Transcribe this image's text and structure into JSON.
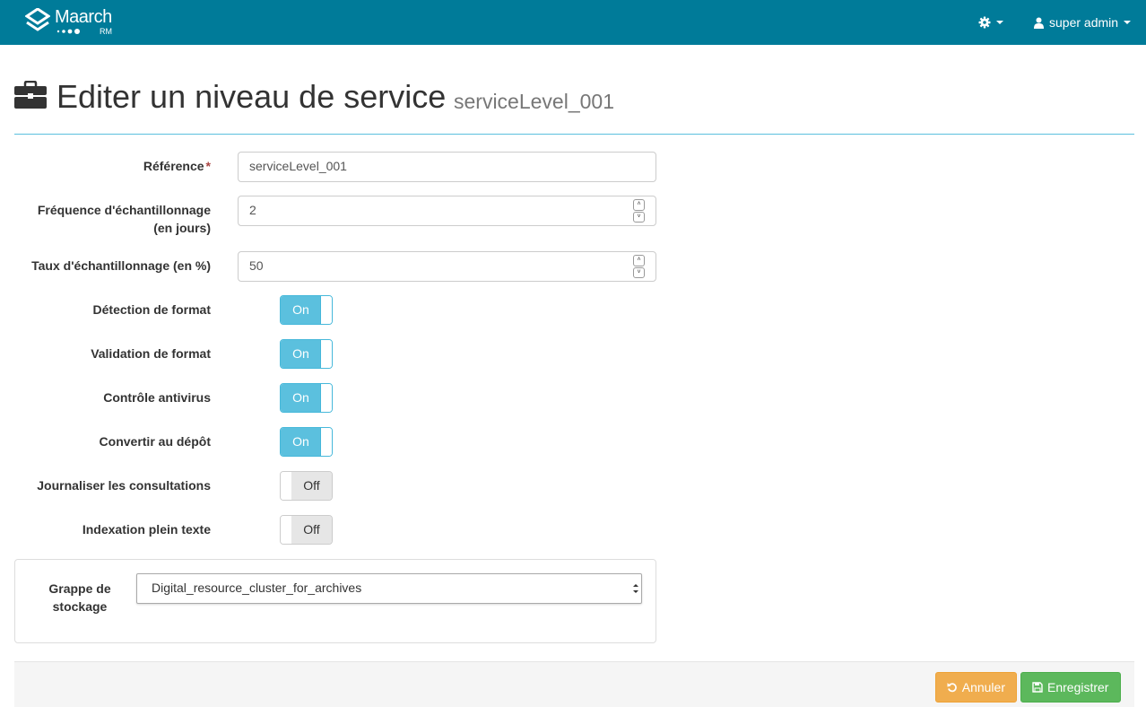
{
  "navbar": {
    "brand": "Maarch",
    "brand_sub": "RM",
    "settings_icon": "gear-icon",
    "user_icon": "user-icon",
    "user_name": "super admin",
    "color": "#007b99"
  },
  "header": {
    "icon": "briefcase-icon",
    "title": "Editer un niveau de service",
    "subtitle": "serviceLevel_001"
  },
  "form": {
    "reference": {
      "label": "Référence",
      "required_mark": "*",
      "value": "serviceLevel_001"
    },
    "frequence": {
      "label_line1": "Fréquence d'échantillonnage",
      "label_line2": "(en jours)",
      "value": "2"
    },
    "taux": {
      "label": "Taux d'échantillonnage (en %)",
      "value": "50"
    },
    "toggles": [
      {
        "label": "Détection de format",
        "state": "On"
      },
      {
        "label": "Validation de format",
        "state": "On"
      },
      {
        "label": "Contrôle antivirus",
        "state": "On"
      },
      {
        "label": "Convertir au dépôt",
        "state": "On"
      },
      {
        "label": "Journaliser les consultations",
        "state": "Off"
      },
      {
        "label": "Indexation plein texte",
        "state": "Off"
      }
    ],
    "grappe": {
      "label_line1": "Grappe de",
      "label_line2": "stockage",
      "value": "Digital_resource_cluster_for_archives"
    }
  },
  "footer": {
    "cancel_label": "Annuler",
    "cancel_icon": "undo-icon",
    "save_label": "Enregistrer",
    "save_icon": "floppy-disk-icon",
    "cancel_color": "#f0ad4e",
    "save_color": "#5cb85c"
  },
  "colors": {
    "toggle_on": "#5bc0de",
    "header_rule": "#5bc0de"
  }
}
